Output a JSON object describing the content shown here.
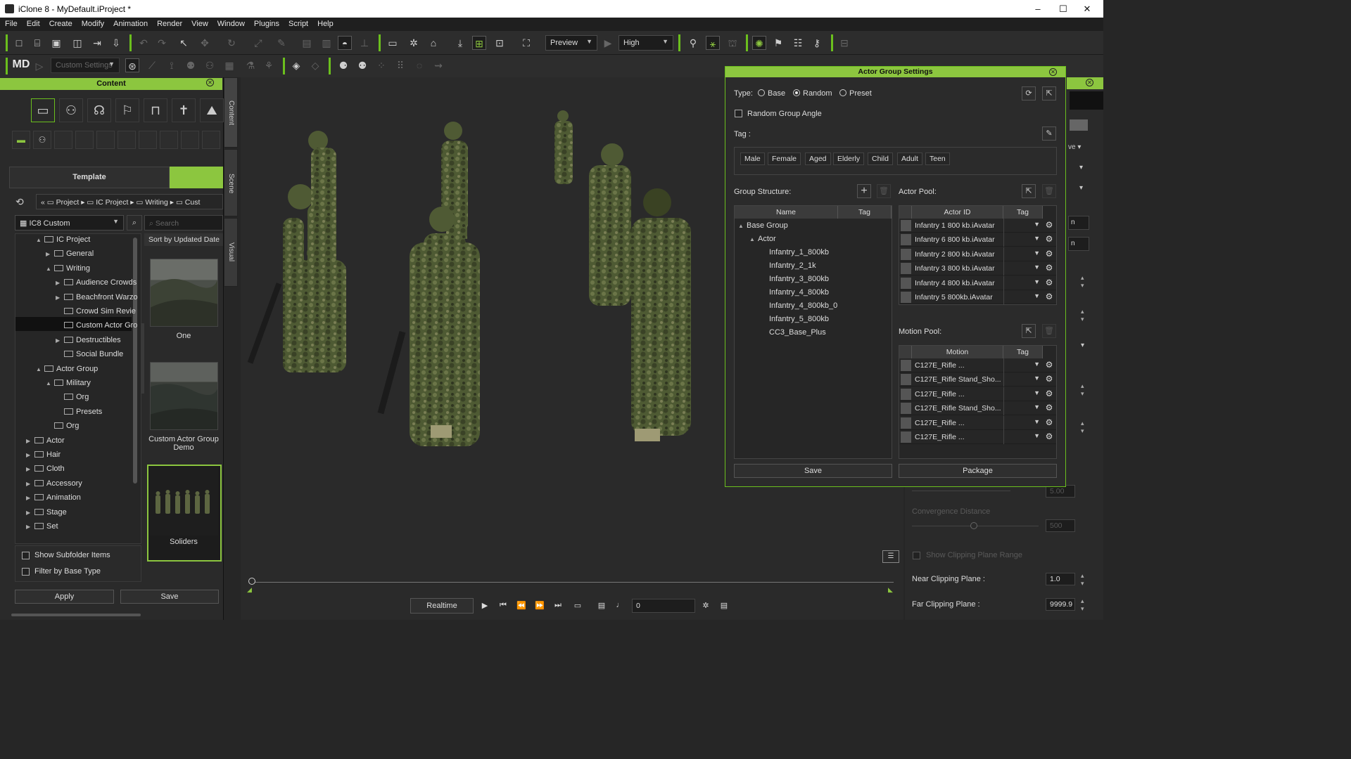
{
  "window": {
    "title": "iClone 8 - MyDefault.iProject *",
    "controls": [
      "–",
      "☐",
      "✕"
    ]
  },
  "menu": [
    "File",
    "Edit",
    "Create",
    "Modify",
    "Animation",
    "Render",
    "View",
    "Window",
    "Plugins",
    "Script",
    "Help"
  ],
  "toolbar": {
    "render_mode": "Preview",
    "quality": "High",
    "custom_settings": "Custom Settings"
  },
  "content": {
    "title": "Content",
    "tabs": {
      "template": "Template",
      "custom": ""
    },
    "breadcrumb": [
      "Project",
      "IC Project",
      "Writing",
      "Cust"
    ],
    "library": "IC8 Custom",
    "search_placeholder": "Search",
    "sort_label": "Sort by Updated Date",
    "tree": [
      {
        "label": "IC Project",
        "indent": 1,
        "arrow": "▲"
      },
      {
        "label": "General",
        "indent": 2,
        "arrow": "▶"
      },
      {
        "label": "Writing",
        "indent": 2,
        "arrow": "▲"
      },
      {
        "label": "Audience Crowds",
        "indent": 3,
        "arrow": "▶"
      },
      {
        "label": "Beachfront Warzo",
        "indent": 3,
        "arrow": "▶"
      },
      {
        "label": "Crowd Sim Revie",
        "indent": 3,
        "arrow": ""
      },
      {
        "label": "Custom Actor Gro",
        "indent": 3,
        "arrow": ""
      },
      {
        "label": "Destructibles",
        "indent": 3,
        "arrow": "▶"
      },
      {
        "label": "Social Bundle",
        "indent": 3,
        "arrow": ""
      },
      {
        "label": "Actor Group",
        "indent": 1,
        "arrow": "▲"
      },
      {
        "label": "Military",
        "indent": 2,
        "arrow": "▲"
      },
      {
        "label": "Org",
        "indent": 3,
        "arrow": ""
      },
      {
        "label": "Presets",
        "indent": 3,
        "arrow": ""
      },
      {
        "label": "Org",
        "indent": 2,
        "arrow": ""
      },
      {
        "label": "Actor",
        "indent": 0,
        "arrow": "▶"
      },
      {
        "label": "Hair",
        "indent": 0,
        "arrow": "▶"
      },
      {
        "label": "Cloth",
        "indent": 0,
        "arrow": "▶"
      },
      {
        "label": "Accessory",
        "indent": 0,
        "arrow": "▶"
      },
      {
        "label": "Animation",
        "indent": 0,
        "arrow": "▶"
      },
      {
        "label": "Stage",
        "indent": 0,
        "arrow": "▶"
      },
      {
        "label": "Set",
        "indent": 0,
        "arrow": "▶"
      }
    ],
    "thumbnails": [
      {
        "label": "One"
      },
      {
        "label": "Custom Actor Group Demo"
      },
      {
        "label": "Soliders"
      }
    ],
    "show_subfolder": "Show Subfolder Items",
    "filter_base": "Filter by Base Type",
    "apply": "Apply",
    "save": "Save"
  },
  "side_tabs": [
    "Content",
    "Scene",
    "Visual"
  ],
  "actor_group": {
    "title": "Actor Group Settings",
    "type_label": "Type:",
    "types": [
      "Base",
      "Random",
      "Preset"
    ],
    "selected_type": "Random",
    "random_angle": "Random Group Angle",
    "tag_label": "Tag :",
    "tags": [
      "Male",
      "Female",
      "Aged",
      "Elderly",
      "Child",
      "Adult",
      "Teen"
    ],
    "group_structure": "Group Structure:",
    "actor_pool": "Actor Pool:",
    "motion_pool": "Motion Pool:",
    "col_name": "Name",
    "col_tag": "Tag",
    "col_actor_id": "Actor ID",
    "col_motion": "Motion",
    "structure": [
      {
        "label": "Base Group",
        "indent": 0,
        "arrow": "▲"
      },
      {
        "label": "Actor",
        "indent": 1,
        "arrow": "▲"
      },
      {
        "label": "Infantry_1_800kb",
        "indent": 2,
        "arrow": ""
      },
      {
        "label": "Infantry_2_1k",
        "indent": 2,
        "arrow": ""
      },
      {
        "label": "Infantry_3_800kb",
        "indent": 2,
        "arrow": ""
      },
      {
        "label": "Infantry_4_800kb",
        "indent": 2,
        "arrow": ""
      },
      {
        "label": "Infantry_4_800kb_0",
        "indent": 2,
        "arrow": ""
      },
      {
        "label": "Infantry_5_800kb",
        "indent": 2,
        "arrow": ""
      },
      {
        "label": "CC3_Base_Plus",
        "indent": 2,
        "arrow": ""
      }
    ],
    "actors": [
      "Infantry 1 800 kb.iAvatar",
      "Infantry 6 800 kb.iAvatar",
      "Infantry 2 800 kb.iAvatar",
      "Infantry 3 800 kb.iAvatar",
      "Infantry 4 800 kb.iAvatar",
      "Infantry 5 800kb.iAvatar"
    ],
    "motions": [
      "C127E_Rifle ...",
      "C127E_Rifle Stand_Sho...",
      "C127E_Rifle ...",
      "C127E_Rifle Stand_Sho...",
      "C127E_Rifle ...",
      "C127E_Rifle ..."
    ],
    "save": "Save",
    "package": "Package"
  },
  "right_panel": {
    "convergence": "Convergence Distance",
    "convergence_value": "500",
    "other_value": "5.00",
    "show_clipping": "Show Clipping Plane Range",
    "near_label": "Near Clipping Plane :",
    "near_value": "1.0",
    "far_label": "Far Clipping Plane :",
    "far_value": "9999.9",
    "partial_labels": [
      "ve",
      "n",
      "n"
    ]
  },
  "playback": {
    "mode": "Realtime",
    "frame": "0"
  },
  "colors": {
    "accent": "#8cc63f",
    "bg": "#2a2a2a",
    "camo": "#4e5a33"
  }
}
